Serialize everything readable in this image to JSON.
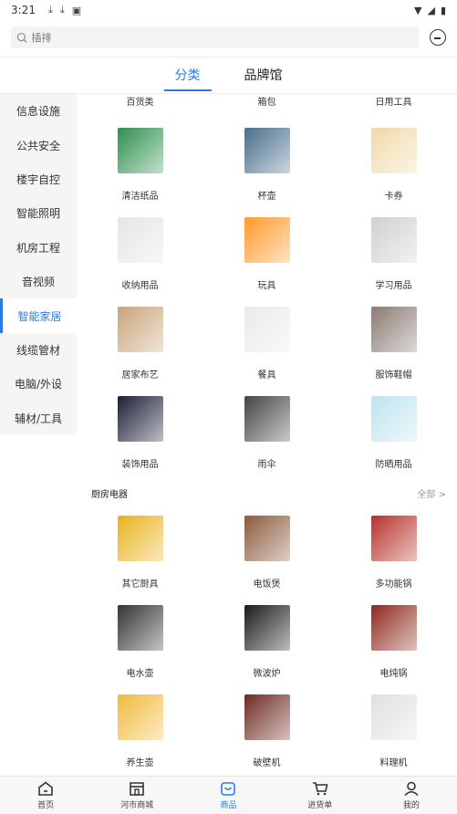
{
  "status_bar": {
    "time": "3:21"
  },
  "search": {
    "placeholder": "插排"
  },
  "tabs": [
    {
      "label": "分类"
    },
    {
      "label": "品牌馆"
    }
  ],
  "sidebar": {
    "items": [
      {
        "label": "信息设施"
      },
      {
        "label": "公共安全"
      },
      {
        "label": "楼宇自控"
      },
      {
        "label": "智能照明"
      },
      {
        "label": "机房工程"
      },
      {
        "label": "音视频"
      },
      {
        "label": "智能家居"
      },
      {
        "label": "线缆管材"
      },
      {
        "label": "电脑/外设"
      },
      {
        "label": "辅材/工具"
      }
    ]
  },
  "top_labels": [
    "百货类",
    "箱包",
    "日用工具"
  ],
  "grid1": [
    {
      "label": "清洁纸品",
      "icon": "tissue-icon",
      "color": "#2f8f4f"
    },
    {
      "label": "杯壶",
      "icon": "thermos-icon",
      "color": "#4a6e8c"
    },
    {
      "label": "卡券",
      "icon": "voucher-icon",
      "color": "#f0d9a8"
    },
    {
      "label": "收纳用品",
      "icon": "storage-box-icon",
      "color": "#e5e5e5"
    },
    {
      "label": "玩具",
      "icon": "toy-icon",
      "color": "#ff9a2b"
    },
    {
      "label": "学习用品",
      "icon": "stationery-icon",
      "color": "#d0d0d0"
    },
    {
      "label": "居家布艺",
      "icon": "sofa-icon",
      "color": "#c9a47a"
    },
    {
      "label": "餐具",
      "icon": "tableware-icon",
      "color": "#eaeaea"
    },
    {
      "label": "服饰鞋帽",
      "icon": "clothes-icon",
      "color": "#8a7a72"
    },
    {
      "label": "装饰用品",
      "icon": "crystal-ball-icon",
      "color": "#1b1d36"
    },
    {
      "label": "雨伞",
      "icon": "umbrella-icon",
      "color": "#444444"
    },
    {
      "label": "防晒用品",
      "icon": "sun-hat-icon",
      "color": "#bfe3ef"
    }
  ],
  "section": {
    "title": "厨房电器",
    "more": "全部 >"
  },
  "grid2": [
    {
      "label": "其它厨具",
      "icon": "pots-icon",
      "color": "#e8b21c"
    },
    {
      "label": "电饭煲",
      "icon": "rice-cooker-icon",
      "color": "#8b5a3c"
    },
    {
      "label": "多功能锅",
      "icon": "multi-pot-icon",
      "color": "#b7312a"
    },
    {
      "label": "电水壶",
      "icon": "kettle-icon",
      "color": "#333333"
    },
    {
      "label": "微波炉",
      "icon": "microwave-icon",
      "color": "#1a1a1a"
    },
    {
      "label": "电炖锅",
      "icon": "stew-pot-icon",
      "color": "#8d2a1f"
    },
    {
      "label": "养生壶",
      "icon": "health-pot-icon",
      "color": "#f2b93b"
    },
    {
      "label": "破壁机",
      "icon": "blender-icon",
      "color": "#6d2b22"
    },
    {
      "label": "料理机",
      "icon": "food-processor-icon",
      "color": "#e0e0e0"
    }
  ],
  "bottom_nav": [
    {
      "label": "首页",
      "icon": "home-icon"
    },
    {
      "label": "河市商城",
      "icon": "store-icon"
    },
    {
      "label": "商品",
      "icon": "goods-icon"
    },
    {
      "label": "进货单",
      "icon": "cart-icon"
    },
    {
      "label": "我的",
      "icon": "user-icon"
    }
  ],
  "colors": {
    "accent": "#2c7be5",
    "sidebar_bg": "#f5f5f5"
  }
}
